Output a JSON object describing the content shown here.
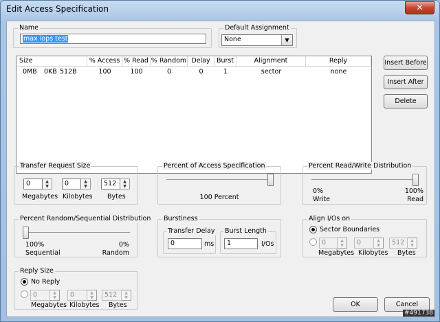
{
  "window": {
    "title": "Edit Access Specification",
    "close_glyph": "✕"
  },
  "name_group": {
    "label": "Name",
    "value": "max iops test"
  },
  "default_assignment": {
    "label": "Default Assignment",
    "value": "None"
  },
  "table": {
    "headers": [
      "Size",
      "% Access",
      "% Read",
      "% Random",
      "Delay",
      "Burst",
      "Alignment",
      "Reply"
    ],
    "rows": [
      {
        "size_mb": "0MB",
        "size_kb": "0KB",
        "size_b": "512B",
        "access": "100",
        "read": "100",
        "random": "0",
        "delay": "0",
        "burst": "1",
        "alignment": "sector",
        "reply": "none"
      }
    ]
  },
  "buttons": {
    "insert_before": "Insert Before",
    "insert_after": "Insert After",
    "delete": "Delete",
    "ok": "OK",
    "cancel": "Cancel"
  },
  "transfer_size": {
    "label": "Transfer Request Size",
    "mb": "0",
    "kb": "0",
    "bytes": "512",
    "mb_label": "Megabytes",
    "kb_label": "Kilobytes",
    "bytes_label": "Bytes"
  },
  "percent_access": {
    "label": "Percent of Access Specification",
    "value_text": "100 Percent",
    "fraction": 1.0
  },
  "read_write": {
    "label": "Percent Read/Write Distribution",
    "left_pct": "0%",
    "left_label": "Write",
    "right_pct": "100%",
    "right_label": "Read",
    "fraction": 1.0
  },
  "random_seq": {
    "label": "Percent Random/Sequential Distribution",
    "left_pct": "100%",
    "left_label": "Sequential",
    "right_pct": "0%",
    "right_label": "Random",
    "fraction": 0.0
  },
  "burstiness": {
    "label": "Burstiness",
    "delay_label": "Transfer Delay",
    "delay_value": "0",
    "delay_unit": "ms",
    "burst_label": "Burst Length",
    "burst_value": "1",
    "burst_unit": "I/Os"
  },
  "align": {
    "label": "Align I/Os on",
    "option1": "Sector Boundaries",
    "mb": "0",
    "kb": "0",
    "bytes": "512",
    "mb_label": "Megabytes",
    "kb_label": "Kilobytes",
    "bytes_label": "Bytes"
  },
  "reply": {
    "label": "Reply Size",
    "option1": "No Reply",
    "mb": "0",
    "kb": "0",
    "bytes": "512",
    "mb_label": "Megabytes",
    "kb_label": "Kilobytes",
    "bytes_label": "Bytes"
  },
  "watermark": "#491738",
  "icons": {
    "spin_up": "▲",
    "spin_down": "▼",
    "dropdown": "▼"
  }
}
